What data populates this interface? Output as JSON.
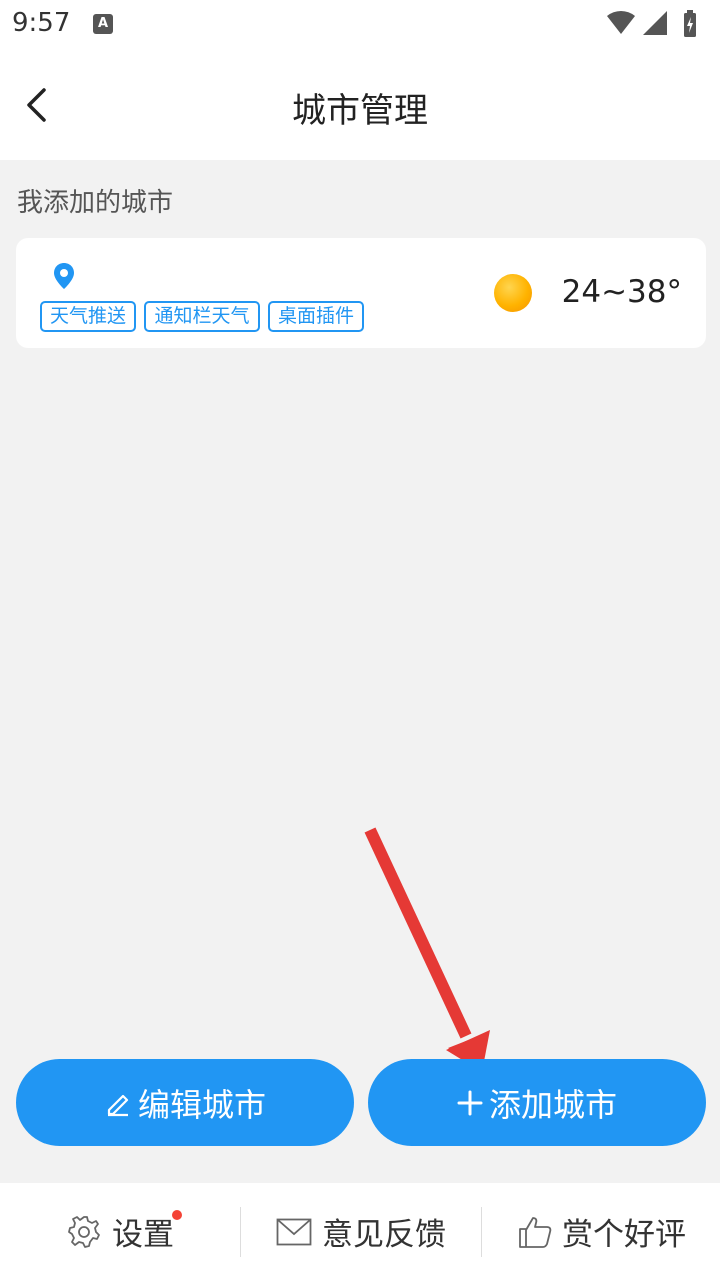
{
  "status_bar": {
    "time": "9:57",
    "notification_icon": "A",
    "icons": [
      "wifi-icon",
      "signal-icon",
      "battery-charging-icon"
    ]
  },
  "header": {
    "back_icon": "chevron-left-icon",
    "title": "城市管理"
  },
  "section": {
    "label": "我添加的城市"
  },
  "city_card": {
    "location_icon": "location-pin-icon",
    "tags": [
      "天气推送",
      "通知栏天气",
      "桌面插件"
    ],
    "weather_icon": "sun-icon",
    "temperature": "24~38°"
  },
  "actions": {
    "edit_label": "编辑城市",
    "edit_icon": "pencil-icon",
    "add_label": "添加城市",
    "add_icon": "plus-icon"
  },
  "bottom_bar": {
    "items": [
      {
        "label": "设置",
        "icon": "gear-icon",
        "badge": true
      },
      {
        "label": "意见反馈",
        "icon": "mail-icon",
        "badge": false
      },
      {
        "label": "赏个好评",
        "icon": "thumbs-up-icon",
        "badge": false
      }
    ]
  },
  "colors": {
    "accent": "#2196f3",
    "badge": "#f44336",
    "annotation_arrow": "#e53935",
    "background": "#f2f2f2"
  }
}
